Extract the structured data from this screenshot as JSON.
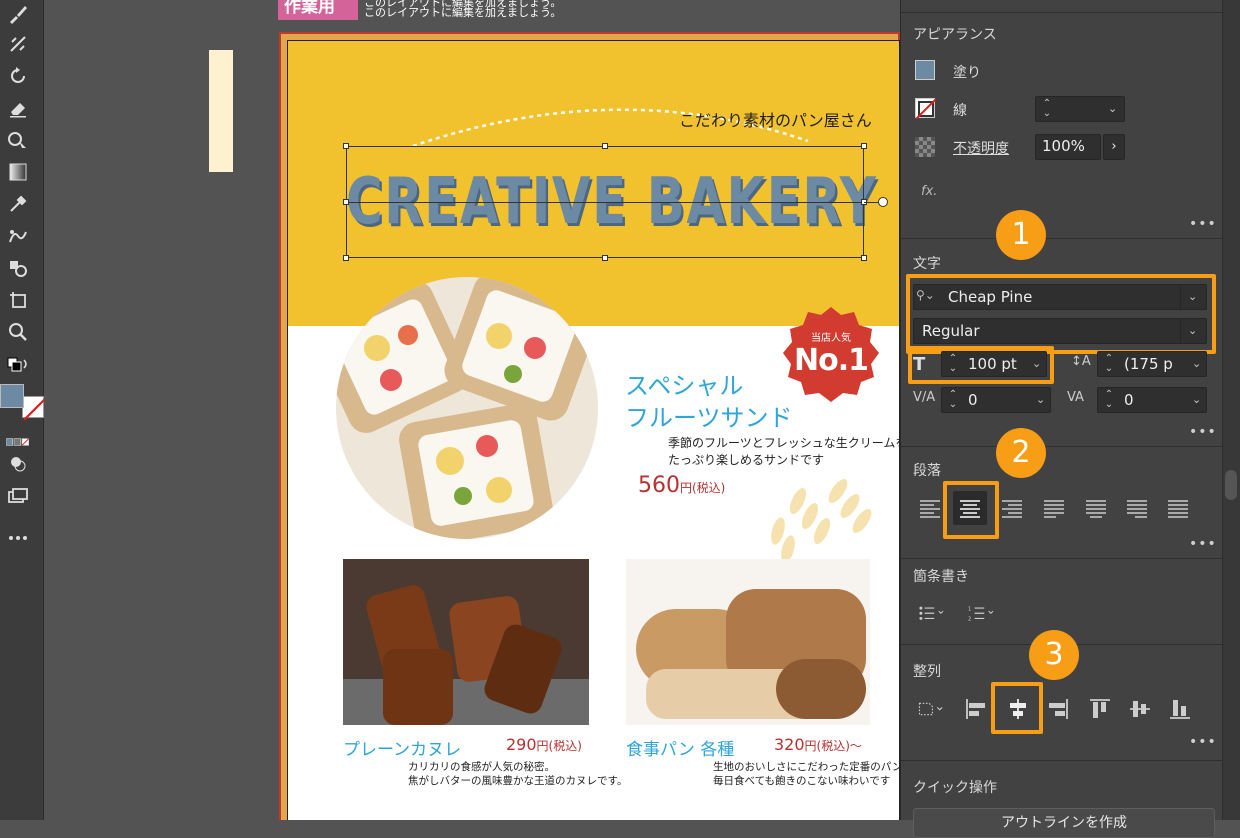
{
  "canvas": {
    "work_tag": "作業用",
    "work_note_1": "このレイアウトに編集を加えましょう。",
    "work_note_2": "このレイアウトに編集を加えましょう。"
  },
  "flyer": {
    "subtitle": "こだわり素材のパン屋さん",
    "title": "CREATIVE BAKERY",
    "badge_top": "当店人気",
    "badge_main": "No.1",
    "special_name_1": "スペシャル",
    "special_name_2": "フルーツサンド",
    "special_desc_1": "季節のフルーツとフレッシュな生クリームを",
    "special_desc_2": "たっぷり楽しめるサンドです",
    "special_price": "560",
    "price_unit": "円(税込)",
    "products": [
      {
        "name": "プレーンカヌレ",
        "price": "290",
        "unit": "円(税込)",
        "desc_1": "カリカリの食感が人気の秘密。",
        "desc_2": "焦がしバターの風味豊かな王道のカヌレです。"
      },
      {
        "name": "食事パン 各種",
        "price": "320",
        "unit": "円(税込)～",
        "desc_1": "生地のおいしさにこだわった定番のパン。",
        "desc_2": "毎日食べても飽きのこない味わいです"
      }
    ]
  },
  "panel": {
    "appearance": {
      "title": "アピアランス",
      "fill_label": "塗り",
      "stroke_label": "線",
      "opacity_label": "不透明度",
      "opacity_value": "100%",
      "fx_label": "fx.",
      "fill_color": "#6d8aa5"
    },
    "character": {
      "title": "文字",
      "font_family": "Cheap Pine",
      "font_style": "Regular",
      "font_size": "100 pt",
      "leading": "(175 p",
      "kerning": "0",
      "tracking": "0"
    },
    "paragraph": {
      "title": "段落"
    },
    "bullets": {
      "title": "箇条書き"
    },
    "align": {
      "title": "整列"
    },
    "quick": {
      "title": "クイック操作",
      "button": "アウトラインを作成"
    },
    "markers": [
      "1",
      "2",
      "3"
    ],
    "more": "•••"
  },
  "colors": {
    "accent": "#f79d16",
    "band": "#f2c12e",
    "title_blue": "#6d8aa5",
    "heading_cyan": "#2ea6d6",
    "price_red": "#b8312f"
  }
}
